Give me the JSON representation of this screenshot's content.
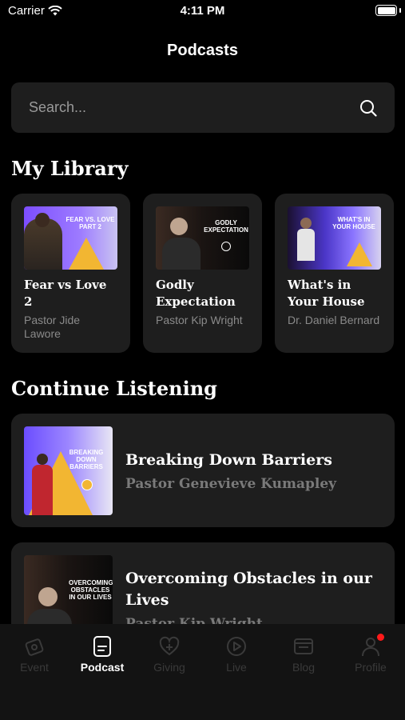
{
  "status_bar": {
    "carrier": "Carrier",
    "time": "4:11 PM"
  },
  "header": {
    "title": "Podcasts"
  },
  "search": {
    "placeholder": "Search..."
  },
  "library": {
    "title": "My Library",
    "items": [
      {
        "title": "Fear vs Love 2",
        "author": "Pastor Jide Lawore",
        "thumb_caption": "FEAR VS. LOVE PART 2"
      },
      {
        "title": "Godly Expectation",
        "author": "Pastor Kip Wright",
        "thumb_caption": "GODLY EXPECTATION"
      },
      {
        "title": "What's in Your House",
        "author": "Dr. Daniel Bernard",
        "thumb_caption": "WHAT'S IN YOUR HOUSE"
      }
    ]
  },
  "continue": {
    "title": "Continue Listening",
    "items": [
      {
        "title": "Breaking Down Barriers",
        "author": "Pastor Genevieve Kumapley",
        "thumb_caption": "BREAKING DOWN BARRIERS"
      },
      {
        "title": "Overcoming Obstacles in our Lives",
        "author": "Pastor Kip Wright",
        "thumb_caption": "OVERCOMING OBSTACLES IN OUR LIVES"
      }
    ]
  },
  "tabs": [
    {
      "label": "Event",
      "icon": "event-icon",
      "active": false
    },
    {
      "label": "Podcast",
      "icon": "podcast-icon",
      "active": true
    },
    {
      "label": "Giving",
      "icon": "giving-icon",
      "active": false
    },
    {
      "label": "Live",
      "icon": "live-icon",
      "active": false
    },
    {
      "label": "Blog",
      "icon": "blog-icon",
      "active": false
    },
    {
      "label": "Profile",
      "icon": "profile-icon",
      "active": false,
      "notification": true
    }
  ],
  "colors": {
    "background": "#000000",
    "card": "#1e1e1e",
    "muted_text": "#8a8a8a",
    "notification": "#ff1a1a"
  }
}
